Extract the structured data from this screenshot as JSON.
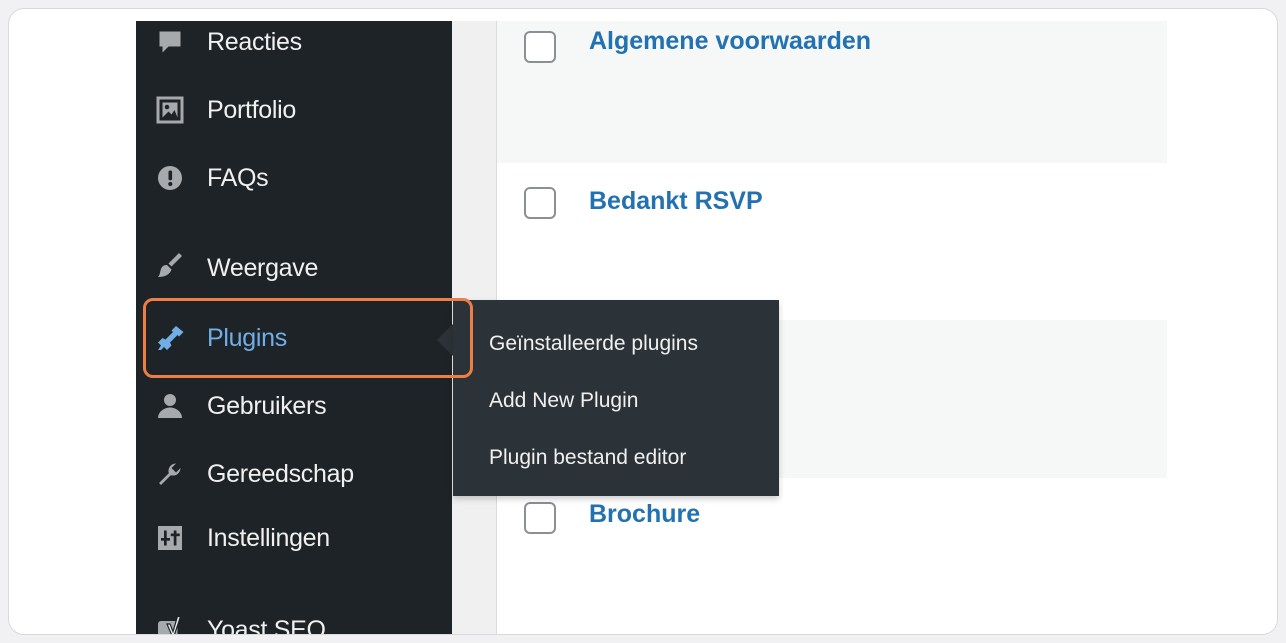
{
  "sidebar": {
    "items": [
      {
        "label": "Reacties",
        "icon": "comment-icon"
      },
      {
        "label": "Portfolio",
        "icon": "portfolio-icon"
      },
      {
        "label": "FAQs",
        "icon": "alert-icon"
      },
      {
        "label": "Weergave",
        "icon": "brush-icon"
      },
      {
        "label": "Plugins",
        "icon": "plugin-icon"
      },
      {
        "label": "Gebruikers",
        "icon": "user-icon"
      },
      {
        "label": "Gereedschap",
        "icon": "wrench-icon"
      },
      {
        "label": "Instellingen",
        "icon": "settings-icon"
      },
      {
        "label": "Yoast SEO",
        "icon": "yoast-icon"
      }
    ]
  },
  "flyout": {
    "items": [
      {
        "label": "Geïnstalleerde plugins"
      },
      {
        "label": "Add New Plugin"
      },
      {
        "label": "Plugin bestand editor"
      }
    ]
  },
  "pages": {
    "rows": [
      {
        "title": "Algemene voorwaarden"
      },
      {
        "title": "Bedankt RSVP"
      },
      {
        "title": ""
      },
      {
        "title": "Brochure"
      }
    ]
  },
  "colors": {
    "sidebar_bg": "#1d2327",
    "flyout_bg": "#2c3338",
    "active_text": "#72aee6",
    "link": "#2271b1",
    "highlight": "#ef7d46"
  }
}
